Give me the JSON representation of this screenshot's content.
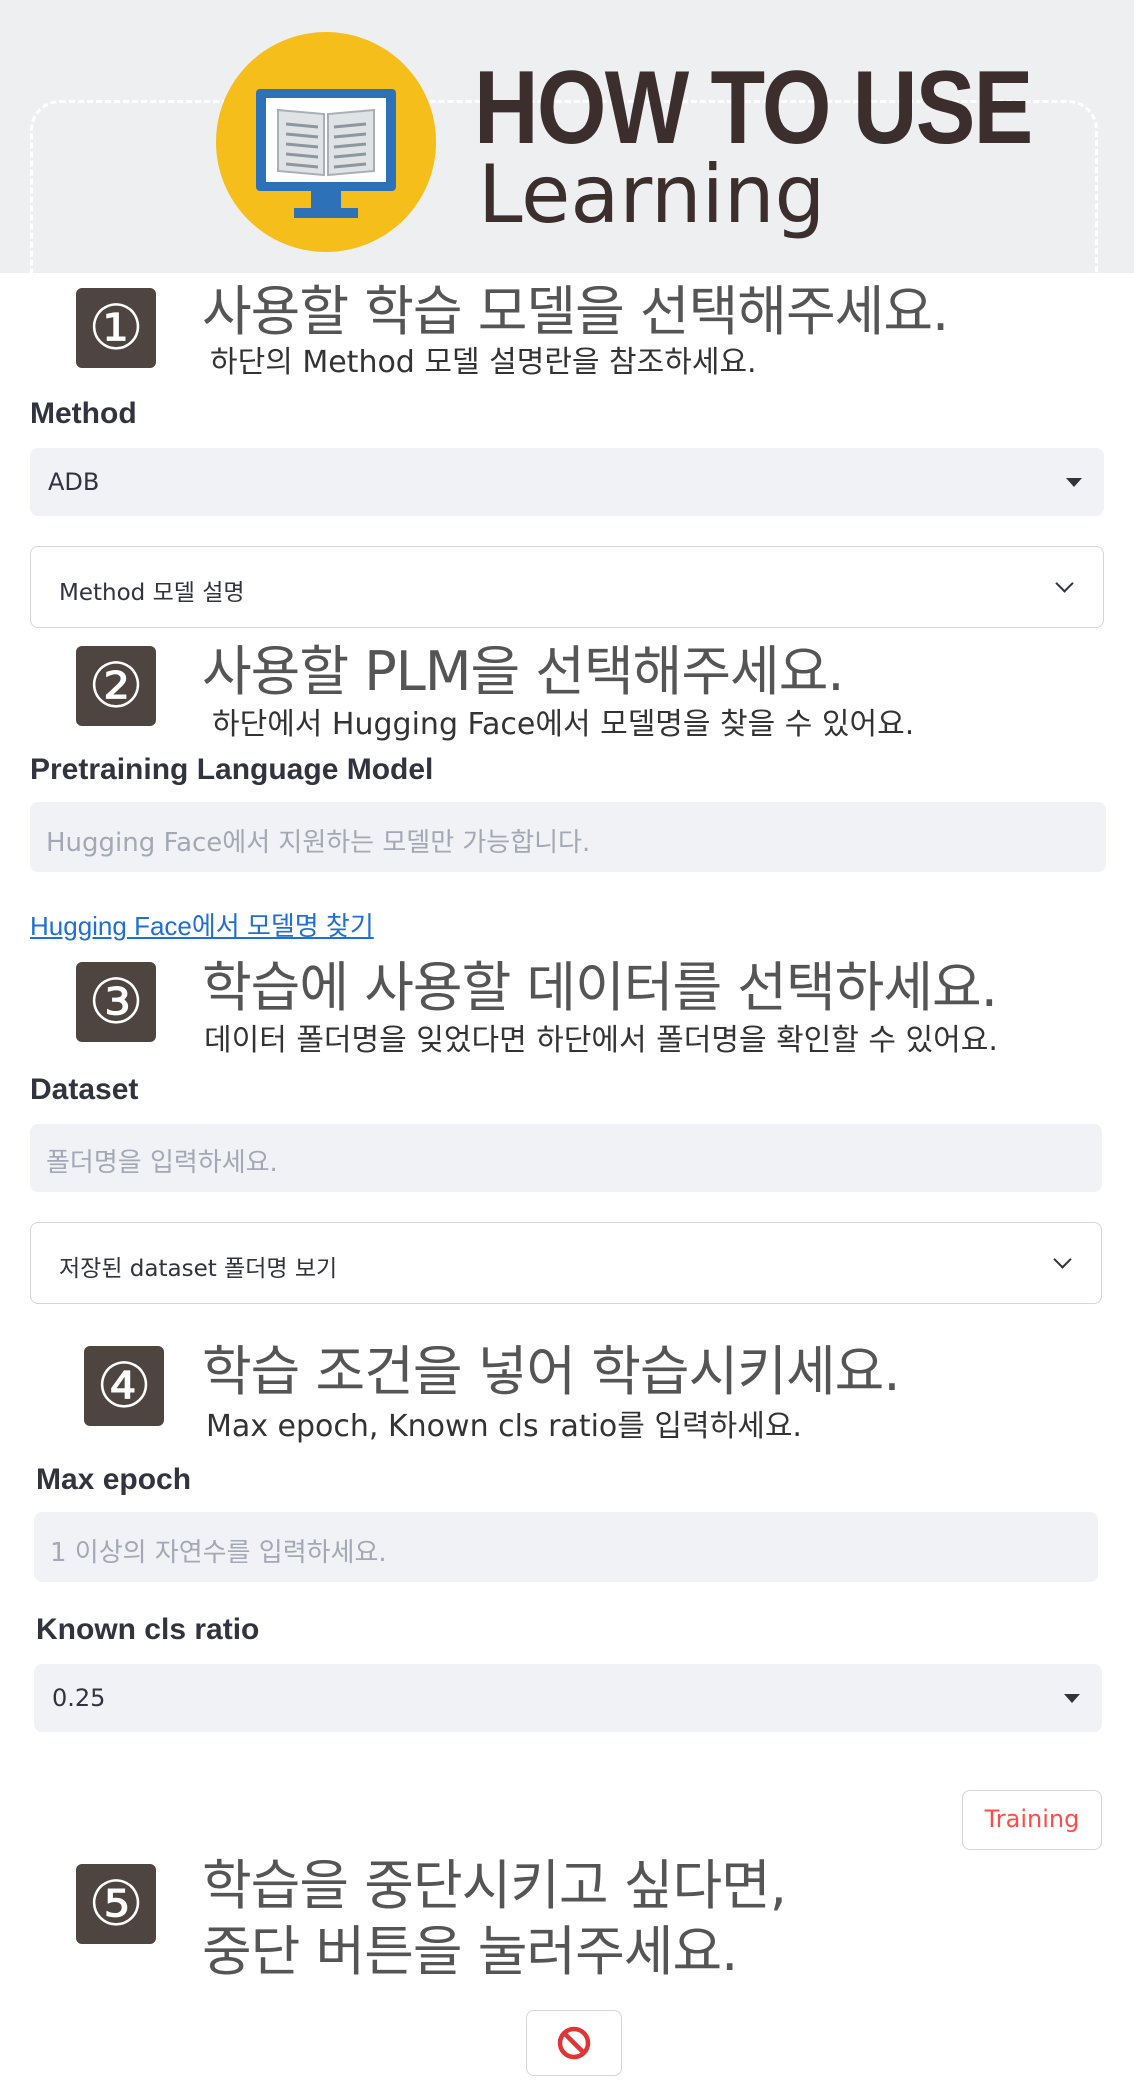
{
  "header": {
    "title_line1": "HOW TO USE",
    "title_line2": "Learning",
    "accent_color": "#f6be1a",
    "icon": "monitor-book-icon"
  },
  "steps": [
    {
      "number": "①",
      "heading": "사용할 학습 모델을 선택해주세요.",
      "sub": "하단의 Method 모델 설명란을 참조하세요."
    },
    {
      "number": "②",
      "heading": "사용할 PLM을 선택해주세요.",
      "sub": "하단에서 Hugging Face에서 모델명을 찾을 수 있어요."
    },
    {
      "number": "③",
      "heading": "학습에 사용할 데이터를 선택하세요.",
      "sub": "데이터 폴더명을 잊었다면 하단에서 폴더명을 확인할 수 있어요."
    },
    {
      "number": "④",
      "heading": "학습 조건을 넣어 학습시키세요.",
      "sub": "Max epoch, Known cls ratio를 입력하세요."
    },
    {
      "number": "⑤",
      "heading_line1": "학습을 중단시키고 싶다면,",
      "heading_line2": "중단 버튼을 눌러주세요."
    }
  ],
  "method": {
    "label": "Method",
    "value": "ADB",
    "expander": "Method 모델 설명"
  },
  "plm": {
    "label": "Pretraining Language Model",
    "placeholder": "Hugging Face에서 지원하는 모델만 가능합니다.",
    "link": "Hugging Face에서 모델명 찾기"
  },
  "dataset": {
    "label": "Dataset",
    "placeholder": "폴더명을 입력하세요.",
    "expander": "저장된 dataset 폴더명 보기"
  },
  "max_epoch": {
    "label": "Max epoch",
    "placeholder": "1 이상의 자연수를 입력하세요."
  },
  "known_cls_ratio": {
    "label": "Known cls ratio",
    "value": "0.25"
  },
  "training_button": {
    "label": "Training",
    "color": "#ff4b4b"
  },
  "stop_button": {
    "icon": "stop-icon",
    "color": "#e03535"
  }
}
